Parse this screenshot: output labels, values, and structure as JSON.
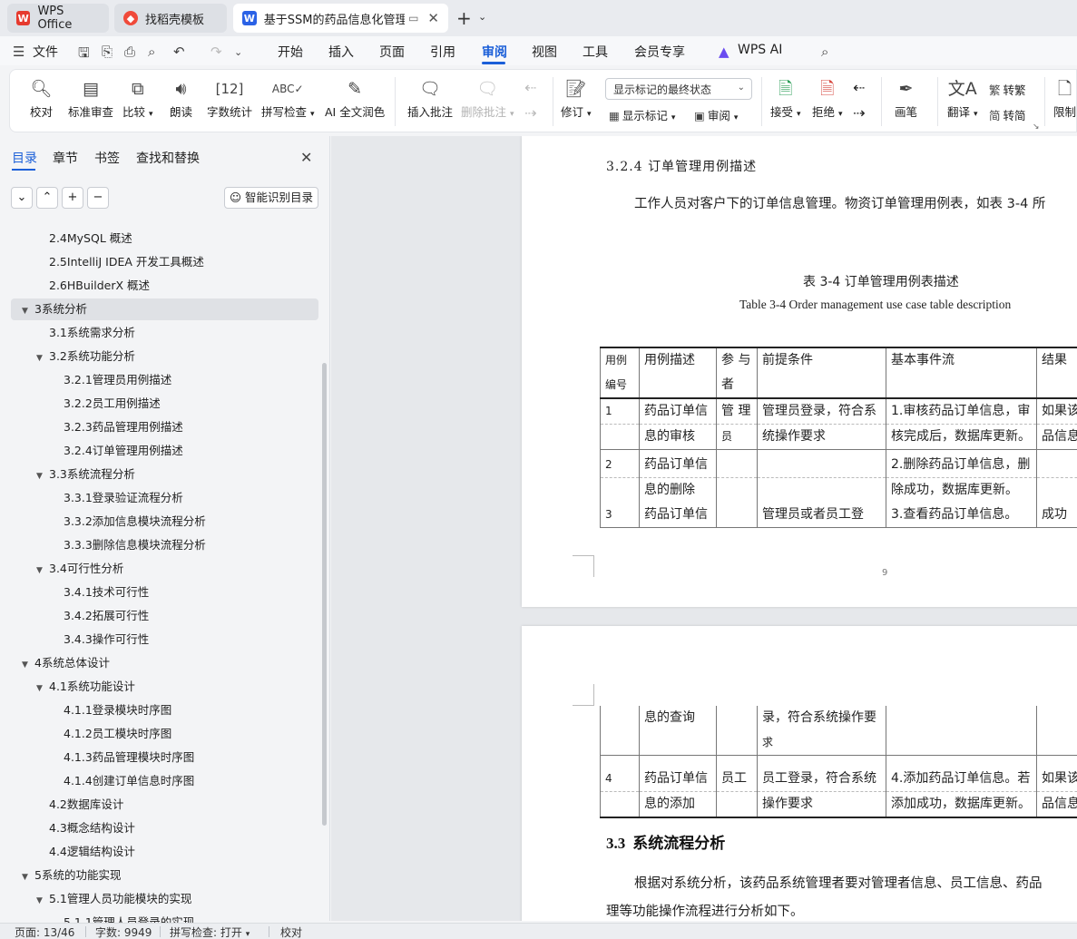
{
  "tabs": {
    "wps": "WPS Office",
    "daoke": "找稻壳模板",
    "doc": "基于SSM的药品信息化管理系统"
  },
  "menu": {
    "file": "文件",
    "items": [
      "开始",
      "插入",
      "页面",
      "引用",
      "审阅",
      "视图",
      "工具",
      "会员专享"
    ],
    "ai": "WPS AI"
  },
  "ribbon": {
    "proofread": "校对",
    "standard_review": "标准审查",
    "compare": "比较",
    "read_aloud": "朗读",
    "word_count": "字数统计",
    "spell_check": "拼写检查",
    "ai_proofread": "AI 全文润色",
    "insert_comment": "插入批注",
    "delete_comment": "删除批注",
    "track_changes": "修订",
    "markup_select": "显示标记的最终状态",
    "show_markup": "显示标记",
    "review_pane": "审阅",
    "accept": "接受",
    "reject": "拒绝",
    "ink": "画笔",
    "translate": "翻译",
    "to_traditional": "转繁",
    "to_simplified": "转简",
    "restrict": "限制"
  },
  "nav": {
    "tabs": [
      "目录",
      "章节",
      "书签",
      "查找和替换"
    ],
    "smart_toc": "智能识别目录",
    "toc": [
      {
        "label": "2.4MySQL 概述",
        "level": 2,
        "arrow": ""
      },
      {
        "label": "2.5IntelliJ IDEA 开发工具概述",
        "level": 2,
        "arrow": ""
      },
      {
        "label": "2.6HBuilderX 概述",
        "level": 2,
        "arrow": ""
      },
      {
        "label": "3系统分析",
        "level": 1,
        "arrow": "▼"
      },
      {
        "label": "3.1系统需求分析",
        "level": 2,
        "arrow": ""
      },
      {
        "label": "3.2系统功能分析",
        "level": 2,
        "arrow": "▼"
      },
      {
        "label": "3.2.1管理员用例描述",
        "level": 3,
        "arrow": ""
      },
      {
        "label": "3.2.2员工用例描述",
        "level": 3,
        "arrow": ""
      },
      {
        "label": "3.2.3药品管理用例描述",
        "level": 3,
        "arrow": ""
      },
      {
        "label": "3.2.4订单管理用例描述",
        "level": 3,
        "arrow": ""
      },
      {
        "label": "3.3系统流程分析",
        "level": 2,
        "arrow": "▼"
      },
      {
        "label": "3.3.1登录验证流程分析",
        "level": 3,
        "arrow": ""
      },
      {
        "label": "3.3.2添加信息模块流程分析",
        "level": 3,
        "arrow": ""
      },
      {
        "label": "3.3.3删除信息模块流程分析",
        "level": 3,
        "arrow": ""
      },
      {
        "label": "3.4可行性分析",
        "level": 2,
        "arrow": "▼"
      },
      {
        "label": "3.4.1技术可行性",
        "level": 3,
        "arrow": ""
      },
      {
        "label": "3.4.2拓展可行性",
        "level": 3,
        "arrow": ""
      },
      {
        "label": "3.4.3操作可行性",
        "level": 3,
        "arrow": ""
      },
      {
        "label": "4系统总体设计",
        "level": 1,
        "arrow": "▼"
      },
      {
        "label": "4.1系统功能设计",
        "level": 2,
        "arrow": "▼"
      },
      {
        "label": "4.1.1登录模块时序图",
        "level": 3,
        "arrow": ""
      },
      {
        "label": "4.1.2员工模块时序图",
        "level": 3,
        "arrow": ""
      },
      {
        "label": "4.1.3药品管理模块时序图",
        "level": 3,
        "arrow": ""
      },
      {
        "label": "4.1.4创建订单信息时序图",
        "level": 3,
        "arrow": ""
      },
      {
        "label": "4.2数据库设计",
        "level": 2,
        "arrow": ""
      },
      {
        "label": "4.3概念结构设计",
        "level": 2,
        "arrow": ""
      },
      {
        "label": "4.4逻辑结构设计",
        "level": 2,
        "arrow": ""
      },
      {
        "label": "5系统的功能实现",
        "level": 1,
        "arrow": "▼"
      },
      {
        "label": "5.1管理人员功能模块的实现",
        "level": 2,
        "arrow": "▼"
      },
      {
        "label": "5.1.1管理人员登录的实现",
        "level": 3,
        "arrow": ""
      }
    ]
  },
  "doc": {
    "section_title": "3.2.4  订单管理用例描述",
    "intro": "工作人员对客户下的订单信息管理。物资订单管理用例表，如表  3-4 所",
    "caption_cn": "表 3-4  订单管理用例表描述",
    "caption_en": "Table 3-4 Order management use case table description",
    "page_number": "9",
    "table_headers": [
      "用例",
      "编号",
      "用例描述",
      "参 与",
      "者",
      "前提条件",
      "基本事件流",
      "结果"
    ],
    "row1": {
      "id": "1",
      "desc1": "药品订单信",
      "desc2": "息的审核",
      "actor1": "管 理",
      "actor2": "员",
      "pre1": "管理员登录，符合系",
      "pre2": "统操作要求",
      "flow1": "1.审核药品订单信息，审",
      "flow2": "核完成后，数据库更新。",
      "res1": "如果该",
      "res2": "品信息"
    },
    "row2": {
      "id": "2",
      "desc1": "药品订单信",
      "desc2": "息的删除",
      "flow1": "2.删除药品订单信息，删",
      "flow2": "除成功，数据库更新。"
    },
    "row3": {
      "id": "3",
      "desc1": "药品订单信",
      "pre1": "管理员或者员工登",
      "flow1": "3.查看药品订单信息。",
      "res1": "成功"
    },
    "row3b": {
      "desc2": "息的查询",
      "pre2": "录，符合系统操作要",
      "pre3": "求"
    },
    "row4": {
      "id": "4",
      "desc1": "药品订单信",
      "desc2": "息的添加",
      "actor1": "员工",
      "pre1": "员工登录，符合系统",
      "pre2": "操作要求",
      "flow1": "4.添加药品订单信息。若",
      "flow2": "添加成功，数据库更新。",
      "res1": "如果该",
      "res2": "品信息"
    },
    "h2_num": "3.3",
    "h2_text": "系统流程分析",
    "para2_line1": "根据对系统分析，该药品系统管理者要对管理者信息、员工信息、药品",
    "para2_line2": "理等功能操作流程进行分析如下。"
  },
  "status": {
    "page": "页面: 13/46",
    "words": "字数: 9949",
    "spell": "拼写检查: 打开",
    "proof": "校对"
  },
  "colors": {
    "accent": "#1b5fd8",
    "wps_red": "#e63a2e",
    "doc_blue": "#2b62e6"
  }
}
